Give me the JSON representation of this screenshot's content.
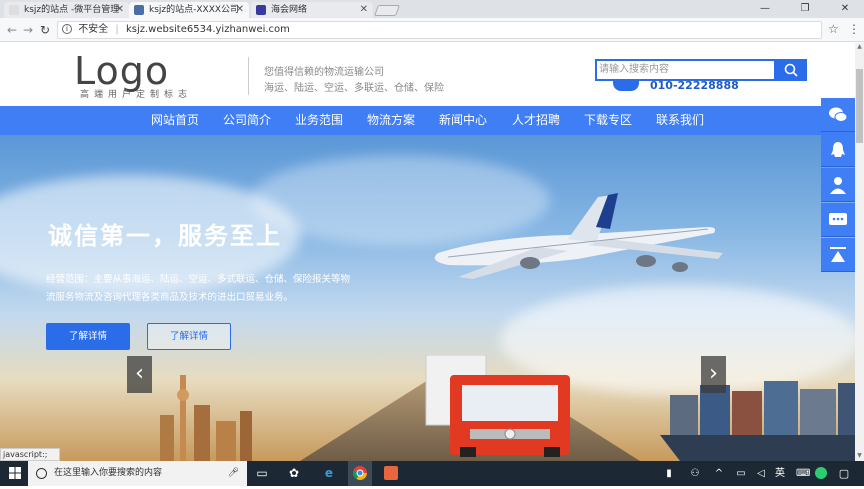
{
  "browser": {
    "tabs": [
      {
        "title": "ksjz的站点 -微平台管理"
      },
      {
        "title": "ksjz的站点-XXXX公司"
      },
      {
        "title": "海会网络"
      }
    ],
    "security_label": "不安全",
    "url": "ksjz.website6534.yizhanwei.com"
  },
  "header": {
    "logo_text": "Logo",
    "logo_subtitle": "高端用户定制标志",
    "slogan_line1": "您值得信赖的物流运输公司",
    "slogan_line2": "海运、陆运、空运、多联运、仓储、保险",
    "search_placeholder": "请输入搜索内容",
    "phone": "010-22228888"
  },
  "nav": {
    "items": [
      "网站首页",
      "公司简介",
      "业务范围",
      "物流方案",
      "新闻中心",
      "人才招聘",
      "下载专区",
      "联系我们"
    ]
  },
  "hero": {
    "headline": "诚信第一，服务至上",
    "description": "经营范围：主要从事海运、陆运、空运、多式联运、仓储、保险报关等物流服务物流及咨询代理各类商品及技术的进出口贸易业务。",
    "button1": "了解详情",
    "button2": "了解详情",
    "prev_arrow": "‹",
    "next_arrow": "›"
  },
  "sidebar_icons": [
    "wechat-icon",
    "qq-icon",
    "user-icon",
    "chat-icon",
    "back-to-top-icon"
  ],
  "status_text": "javascript:;",
  "taskbar": {
    "search_placeholder": "在这里输入你要搜索的内容"
  },
  "colors": {
    "accent": "#3f7ef5",
    "phone": "#1e5ac8"
  }
}
